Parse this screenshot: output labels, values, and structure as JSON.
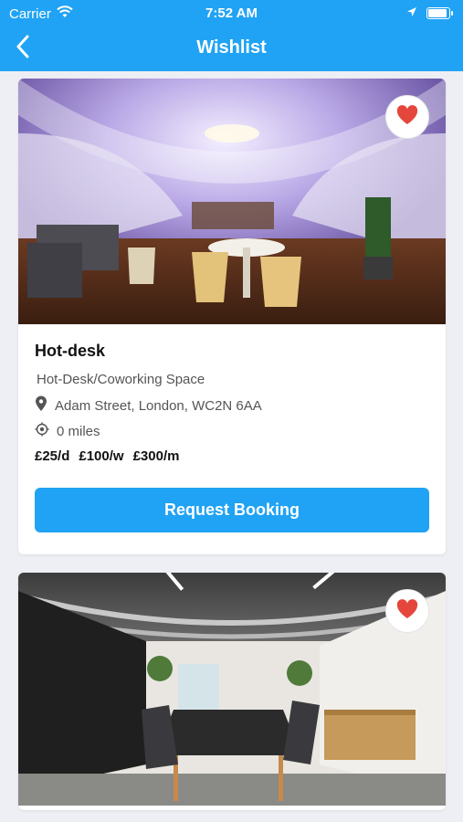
{
  "status_bar": {
    "carrier": "Carrier",
    "time": "7:52 AM",
    "battery_level": 0.9
  },
  "nav": {
    "title": "Wishlist",
    "back_icon": "chevron-left-icon"
  },
  "listings": [
    {
      "name": "Hot-desk",
      "type": "Hot-Desk/Coworking Space",
      "address": "Adam Street, London, WC2N 6AA",
      "distance": "0 miles",
      "prices": [
        "£25/d",
        "£100/w",
        "£300/m"
      ],
      "button_label": "Request Booking",
      "favorited": true
    },
    {
      "favorited": true
    }
  ],
  "colors": {
    "accent": "#20a3f4",
    "heart": "#e4463c",
    "background": "#eeeff4"
  }
}
